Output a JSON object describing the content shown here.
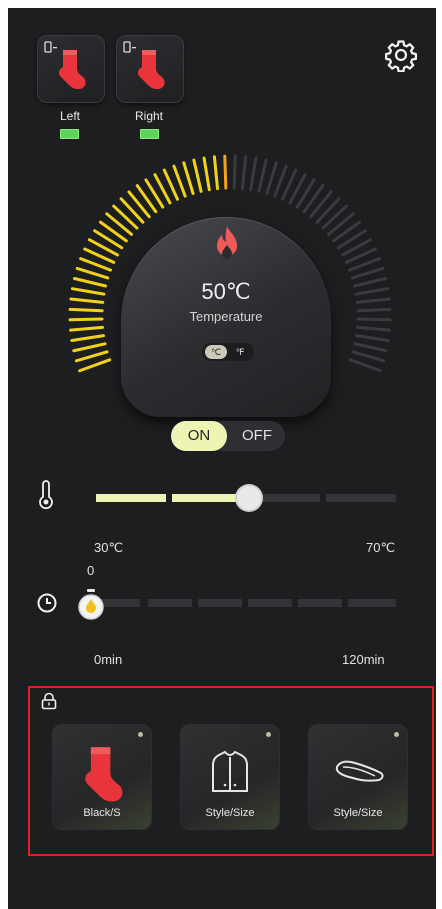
{
  "devices": [
    {
      "label": "Left",
      "icon": "sock-icon",
      "battery": "full"
    },
    {
      "label": "Right",
      "icon": "sock-icon",
      "battery": "full"
    }
  ],
  "settings_icon": "gear-icon",
  "dial": {
    "value": "50℃",
    "label": "Temperature",
    "units": {
      "c": "℃",
      "f": "℉",
      "selected": "c"
    },
    "level_fraction": 0.5
  },
  "power": {
    "on_label": "ON",
    "off_label": "OFF",
    "state": "on"
  },
  "temperature_slider": {
    "icon": "thermometer-icon",
    "min_label": "30℃",
    "max_label": "70℃",
    "fraction": 0.5
  },
  "timer_slider": {
    "icon": "clock-icon",
    "value_label": "0",
    "min_label": "0min",
    "max_label": "120min",
    "fraction": 0
  },
  "accessories_lock_icon": "lock-icon",
  "accessories": [
    {
      "label": "Black/S",
      "icon": "sock-icon"
    },
    {
      "label": "Style/Size",
      "icon": "vest-icon"
    },
    {
      "label": "Style/Size",
      "icon": "insole-icon"
    }
  ],
  "colors": {
    "accent": "#eef4b4",
    "dial_active": "#f0d21c",
    "highlight": "#e02020",
    "sock_red": "#e8343a"
  }
}
